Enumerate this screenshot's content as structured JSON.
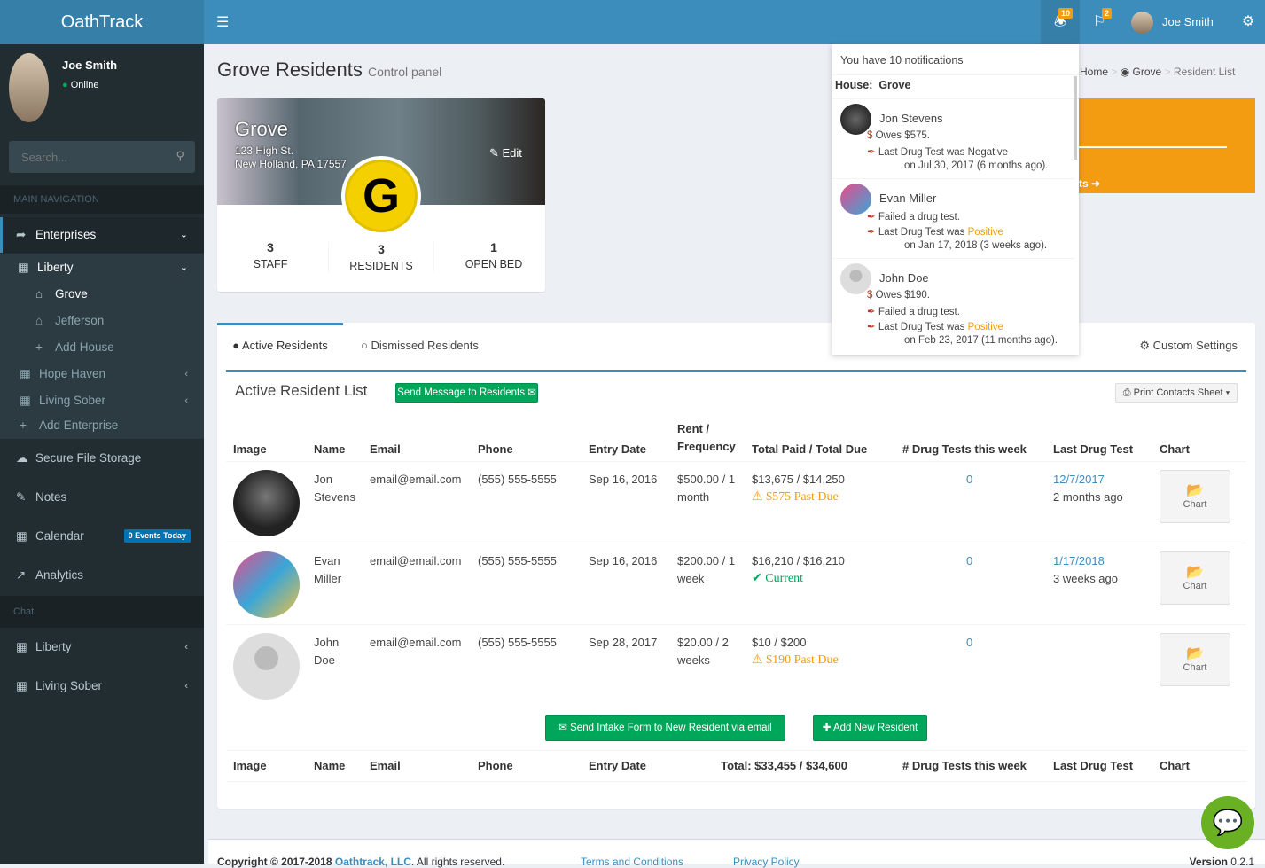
{
  "app": {
    "logo": "OathTrack",
    "user_name": "Joe Smith",
    "status": "Online",
    "notif_count": "10",
    "flag_count": "2"
  },
  "sidebar": {
    "search_placeholder": "Search...",
    "main_nav": "MAIN NAVIGATION",
    "chat": "Chat",
    "items": [
      {
        "label": "Enterprises",
        "icon": "share-icon"
      },
      {
        "label": "Liberty",
        "icon": "building-icon"
      },
      {
        "label": "Grove",
        "icon": "home-icon"
      },
      {
        "label": "Jefferson",
        "icon": "home-icon"
      },
      {
        "label": "Add House",
        "icon": "plus-icon"
      },
      {
        "label": "Hope Haven",
        "icon": "building-icon"
      },
      {
        "label": "Living Sober",
        "icon": "building-icon"
      },
      {
        "label": "Add Enterprise",
        "icon": "plus-icon"
      },
      {
        "label": "Secure File Storage",
        "icon": "cloud-icon"
      },
      {
        "label": "Notes",
        "icon": "edit-icon"
      },
      {
        "label": "Calendar",
        "icon": "calendar-icon",
        "badge": "0 Events Today"
      },
      {
        "label": "Analytics",
        "icon": "line-chart-icon"
      }
    ],
    "chat_items": [
      {
        "label": "Liberty"
      },
      {
        "label": "Living Sober"
      }
    ]
  },
  "page": {
    "title": "Grove Residents",
    "subtitle": "Control panel",
    "breadcrumb": [
      "Home",
      "Grove",
      "Resident List"
    ]
  },
  "house": {
    "name": "Grove",
    "address1": "123 High St.",
    "address2": "New Holland, PA 17557",
    "edit": "Edit",
    "initial": "G",
    "stats": [
      {
        "value": "3",
        "label": "STAFF"
      },
      {
        "value": "3",
        "label": "RESIDENTS"
      },
      {
        "value": "1",
        "label": "OPEN BED"
      }
    ]
  },
  "notifications": {
    "header": "You have 10 notifications",
    "house_label": "House:",
    "house": "Grove",
    "items": [
      {
        "name": "Jon Stevens",
        "lines": [
          {
            "icon": "dollar-icon",
            "text": "Owes $575."
          },
          {
            "icon": "eyedropper-icon",
            "text": "Last Drug Test was ",
            "result": "Negative"
          },
          {
            "text": "on Jul 30, 2017 (6 months ago)."
          }
        ]
      },
      {
        "name": "Evan Miller",
        "lines": [
          {
            "icon": "eyedropper-icon",
            "text": "Failed a drug test."
          },
          {
            "icon": "eyedropper-icon",
            "text": "Last Drug Test was ",
            "result": "Positive"
          },
          {
            "text": "on Jan 17, 2018 (3 weeks ago)."
          }
        ]
      },
      {
        "name": "John Doe",
        "lines": [
          {
            "icon": "dollar-icon",
            "text": "Owes $190."
          },
          {
            "icon": "eyedropper-icon",
            "text": "Failed a drug test."
          },
          {
            "icon": "eyedropper-icon",
            "text": "Last Drug Test was ",
            "result": "Positive"
          },
          {
            "text": "on Feb 23, 2017 (11 months ago)."
          }
        ]
      }
    ]
  },
  "tabs": [
    {
      "label": "Active Residents",
      "active": true
    },
    {
      "label": "Dismissed Residents"
    }
  ],
  "custom_settings": "Custom Settings",
  "list": {
    "title": "Active Resident List",
    "send_message": "Send Message to Residents",
    "print": "Print Contacts Sheet",
    "headers": [
      "Image",
      "Name",
      "Email",
      "Phone",
      "Entry Date",
      "Rent / Frequency",
      "Total Paid / Total Due",
      "# Drug Tests this week",
      "Last Drug Test",
      "Chart"
    ],
    "rows": [
      {
        "name": "Jon Stevens",
        "email": "email@email.com",
        "phone": "(555) 555-5555",
        "entry": "Sep 16, 2016",
        "rent": "$500.00 / 1 month",
        "total": "$13,675 / $14,250",
        "status": "$575 Past Due",
        "status_type": "warning",
        "tests": "0",
        "last": "12/7/2017",
        "last_ago": "2 months ago",
        "chart": "Chart"
      },
      {
        "name": "Evan Miller",
        "email": "email@email.com",
        "phone": "(555) 555-5555",
        "entry": "Sep 16, 2016",
        "rent": "$200.00 / 1 week",
        "total": "$16,210 / $16,210",
        "status": "Current",
        "status_type": "ok",
        "tests": "0",
        "last": "1/17/2018",
        "last_ago": "3 weeks ago",
        "chart": "Chart"
      },
      {
        "name": "John Doe",
        "email": "email@email.com",
        "phone": "(555) 555-5555",
        "entry": "Sep 28, 2017",
        "rent": "$20.00 / 2 weeks",
        "total": "$10 / $200",
        "status": "$190 Past Due",
        "status_type": "warning",
        "tests": "0",
        "last": "",
        "last_ago": "",
        "chart": "Chart"
      }
    ],
    "intake": "Send Intake Form to New Resident via email",
    "add_resident": "Add New Resident",
    "footer_total": "Total: $33,455 / $34,600"
  },
  "footer": {
    "copyright": "Copyright © 2017-2018 ",
    "company": "Oathtrack, LLC",
    "rights": ". All rights reserved.",
    "terms": "Terms and Conditions",
    "privacy": "Privacy Policy",
    "version_label": "Version",
    "version": "0.2.1"
  },
  "colors": {
    "header": "#3c8dbc",
    "sidebar": "#222d32",
    "accent_orange": "#f39c12",
    "success": "#00a65a"
  }
}
